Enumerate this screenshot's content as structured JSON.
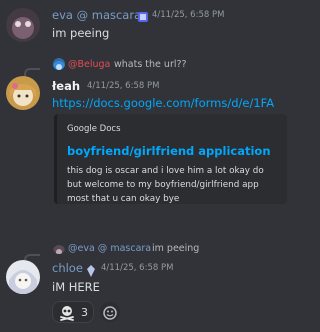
{
  "messages": [
    {
      "author": "eva @ mascara",
      "author_color": "#7a9cc6",
      "timestamp": "4/11/25, 6:58 PM",
      "content": "im peeing"
    },
    {
      "reply": {
        "mention": "@Beluga",
        "text": "whats the url??"
      },
      "author": "łeah",
      "timestamp": "4/11/25, 6:58 PM",
      "link": "https://docs.google.com/forms/d/e/1FA",
      "embed": {
        "provider": "Google Docs",
        "title": "boyfriend/girlfriend application",
        "description": [
          "this dog is oscar and i love him a lot okay do",
          "but welcome to my boyfriend/girlfriend app",
          "most that u can okay bye"
        ]
      }
    },
    {
      "reply": {
        "mention": "@eva @ mascara",
        "text": "im peeing"
      },
      "author": "chloe",
      "author_color": "#7a9cc6",
      "timestamp": "4/11/25, 6:58 PM",
      "content": "iM HERE",
      "reactions": [
        {
          "emoji": "skull-crossbones",
          "count": "3"
        }
      ]
    }
  ],
  "colors": {
    "background": "#313338",
    "link": "#00a8fc",
    "mention_red": "#e24e55"
  }
}
